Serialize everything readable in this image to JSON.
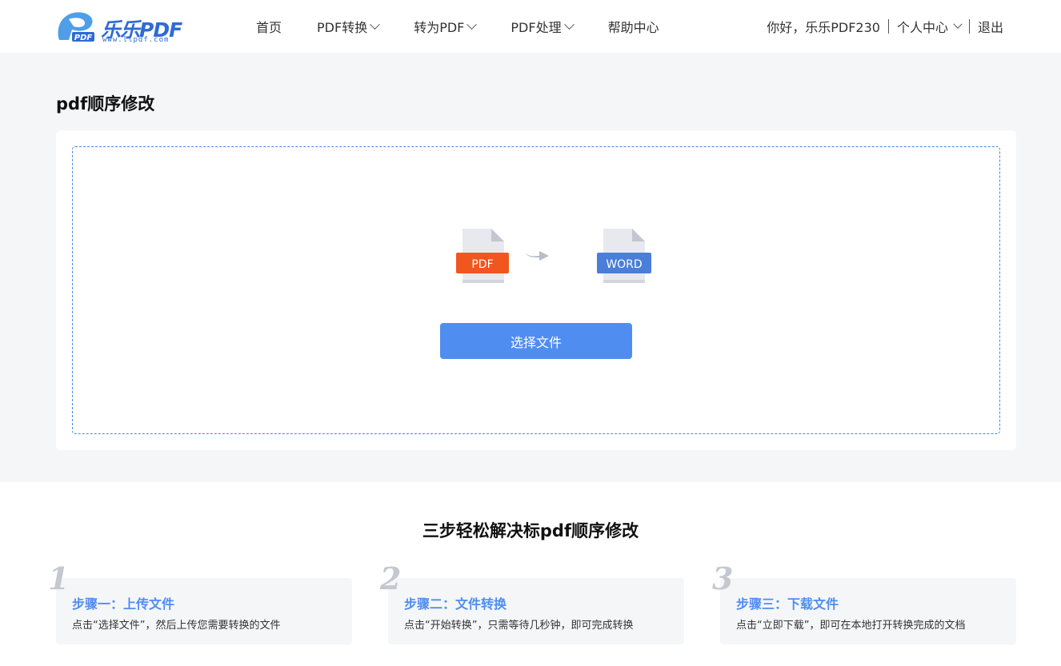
{
  "header": {
    "logo_text": "乐乐PDF",
    "logo_sub": "www.llpdf.com",
    "logo_badge": "PDF",
    "nav": [
      {
        "label": "首页",
        "dropdown": false
      },
      {
        "label": "PDF转换",
        "dropdown": true
      },
      {
        "label": "转为PDF",
        "dropdown": true
      },
      {
        "label": "PDF处理",
        "dropdown": true
      },
      {
        "label": "帮助中心",
        "dropdown": false
      }
    ],
    "greeting": "你好，乐乐PDF230",
    "user_center": "个人中心",
    "logout": "退出"
  },
  "main": {
    "title": "pdf顺序修改",
    "from_label": "PDF",
    "to_label": "WORD",
    "select_button": "选择文件"
  },
  "steps": {
    "title": "三步轻松解决标pdf顺序修改",
    "items": [
      {
        "num": "1",
        "title": "步骤一：上传文件",
        "desc": "点击“选择文件”，然后上传您需要转换的文件"
      },
      {
        "num": "2",
        "title": "步骤二：文件转换",
        "desc": "点击“开始转换”，只需等待几秒钟，即可完成转换"
      },
      {
        "num": "3",
        "title": "步骤三：下载文件",
        "desc": "点击“立即下载”，即可在本地打开转换完成的文档"
      }
    ]
  },
  "colors": {
    "accent": "#4f8ef0",
    "brand": "#2f6bd4",
    "pdf_badge": "#f2561f",
    "word_badge": "#4a7ed8",
    "background": "#f5f6f8"
  },
  "icons": {
    "logo": "llpdf-logo-icon",
    "pdf": "pdf-file-icon",
    "word": "word-file-icon",
    "arrow": "arrow-right-icon"
  }
}
